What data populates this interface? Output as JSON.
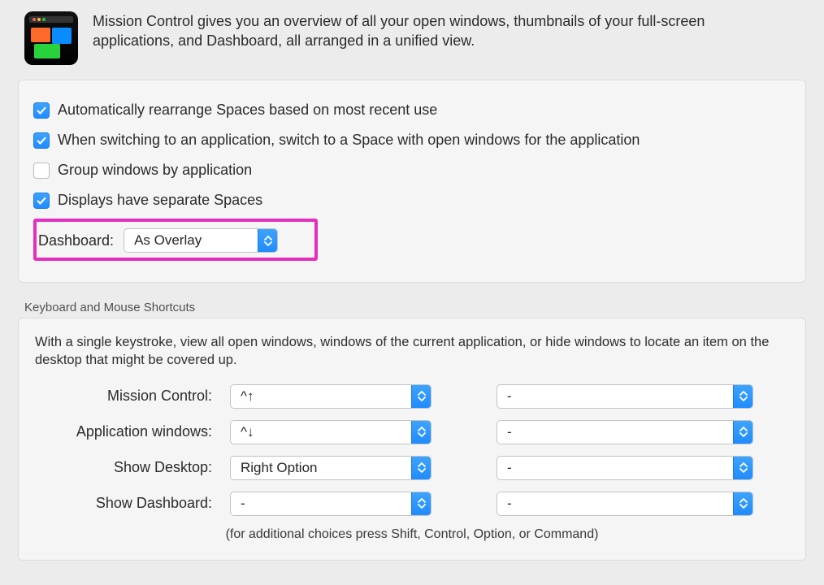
{
  "header": {
    "description": "Mission Control gives you an overview of all your open windows, thumbnails of your full-screen applications, and Dashboard, all arranged in a unified view."
  },
  "options": {
    "auto_rearrange": {
      "checked": true,
      "label": "Automatically rearrange Spaces based on most recent use"
    },
    "switch_space": {
      "checked": true,
      "label": "When switching to an application, switch to a Space with open windows for the application"
    },
    "group_windows": {
      "checked": false,
      "label": "Group windows by application"
    },
    "separate_spaces": {
      "checked": true,
      "label": "Displays have separate Spaces"
    }
  },
  "dashboard": {
    "label": "Dashboard:",
    "value": "As Overlay",
    "highlight_color": "#e22fc0"
  },
  "shortcuts": {
    "section_title": "Keyboard and Mouse Shortcuts",
    "description": "With a single keystroke, view all open windows, windows of the current application, or hide windows to locate an item on the desktop that might be covered up.",
    "rows": [
      {
        "label": "Mission Control:",
        "keyboard": "^↑",
        "mouse": "-"
      },
      {
        "label": "Application windows:",
        "keyboard": "^↓",
        "mouse": "-"
      },
      {
        "label": "Show Desktop:",
        "keyboard": "Right Option",
        "mouse": "-"
      },
      {
        "label": "Show Dashboard:",
        "keyboard": "-",
        "mouse": "-"
      }
    ],
    "footnote": "(for additional choices press Shift, Control, Option, or Command)"
  }
}
